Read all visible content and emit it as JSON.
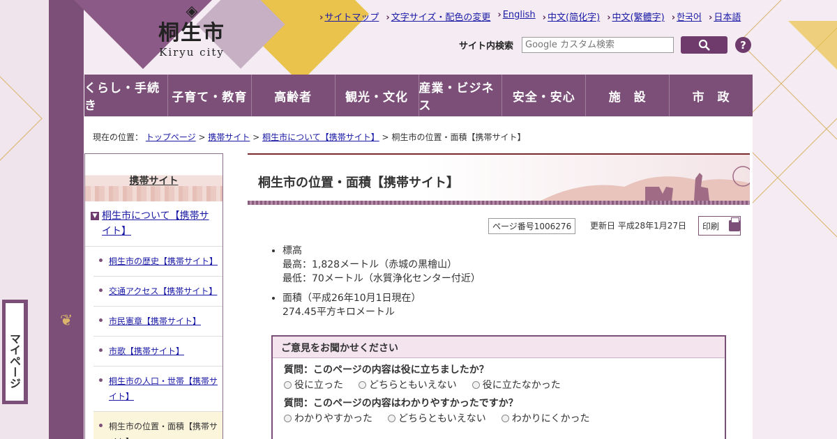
{
  "logo": {
    "mark": "◈",
    "kanji": "桐生市",
    "roman": "Kiryu city"
  },
  "toplinks": [
    "サイトマップ",
    "文字サイズ・配色の変更",
    "English",
    "中文(简化字)",
    "中文(繁體字)",
    "한국어",
    "日本語"
  ],
  "search": {
    "label": "サイト内検索",
    "placeholder": "Google カスタム検索",
    "help": "?"
  },
  "gnav": [
    "くらし・手続き",
    "子育て・教育",
    "高齢者",
    "観光・文化",
    "産業・ビジネス",
    "安全・安心",
    "施　設",
    "市　政"
  ],
  "breadcrumb": {
    "prefix": "現在の位置：",
    "links": [
      "トップページ",
      "携帯サイト",
      "桐生市について【携帯サイト】"
    ],
    "current": "桐生市の位置・面積【携帯サイト】",
    "sep": ">"
  },
  "sidebar": {
    "title": "携帯サイト",
    "parent": "桐生市について【携帯サイト】",
    "items": [
      "桐生市の歴史【携帯サイト】",
      "交通アクセス【携帯サイト】",
      "市民憲章【携帯サイト】",
      "市歌【携帯サイト】",
      "桐生市の人口・世帯【携帯サイト】"
    ],
    "current": "桐生市の位置・面積【携帯サイト】"
  },
  "page": {
    "title": "桐生市の位置・面積【携帯サイト】",
    "page_no": "ページ番号1006276",
    "updated": "更新日 平成28年1月27日",
    "print": "印刷"
  },
  "content": {
    "items": [
      {
        "head": "標高",
        "lines": [
          "最高：1,828メートル（赤城の黒檜山）",
          "最低：70メートル（水質浄化センター付近）"
        ]
      },
      {
        "head": "面積（平成26年10月1日現在）",
        "lines": [
          "274.45平方キロメートル"
        ]
      }
    ]
  },
  "feedback": {
    "title": "ご意見をお聞かせください",
    "q1": "質問：このページの内容は役に立ちましたか？",
    "q1_opts": [
      "役に立った",
      "どちらともいえない",
      "役に立たなかった"
    ],
    "q2": "質問：このページの内容はわかりやすかったですか？",
    "q2_opts": [
      "わかりやすかった",
      "どちらともいえない",
      "わかりにくかった"
    ]
  },
  "mypage": "マイページ",
  "colors": {
    "brand": "#7b4f78",
    "link": "#1a1aa6",
    "heading_rule": "#7a2a2a"
  }
}
